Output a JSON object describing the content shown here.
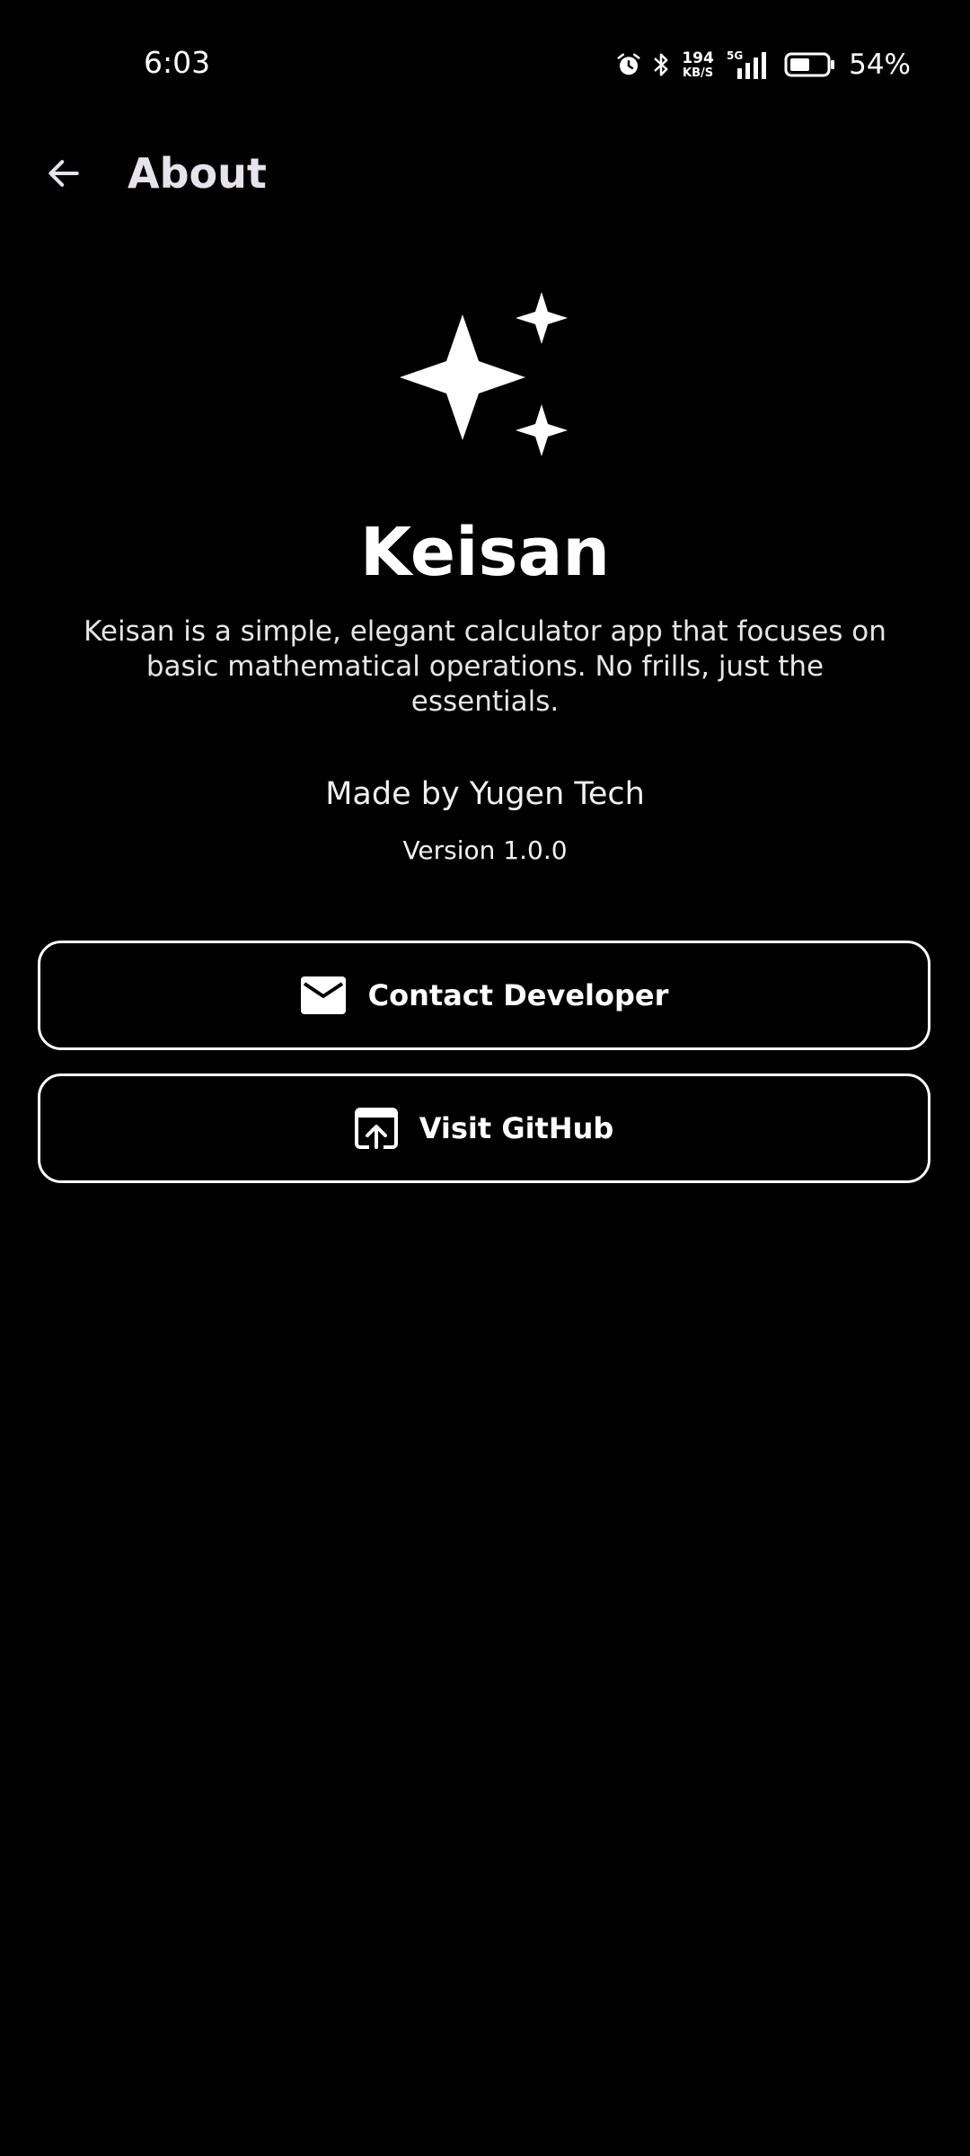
{
  "status_bar": {
    "time": "6:03",
    "net_speed_value": "194",
    "net_speed_unit": "KB/S",
    "network_type": "5G",
    "battery_percent": "54%",
    "battery_level": 0.54
  },
  "app_bar": {
    "title": "About"
  },
  "app": {
    "name": "Keisan",
    "description": "Keisan is a simple, elegant calculator app that focuses on basic mathematical operations. No frills, just the essentials.",
    "made_by": "Made by Yugen Tech",
    "version": "Version 1.0.0",
    "logo_icon": "sparkles-icon"
  },
  "actions": {
    "contact_label": "Contact Developer",
    "contact_icon": "mail-icon",
    "github_label": "Visit GitHub",
    "github_icon": "open-in-browser-icon"
  },
  "colors": {
    "background": "#000000",
    "foreground": "#ffffff",
    "title": "#e6e3ea"
  }
}
